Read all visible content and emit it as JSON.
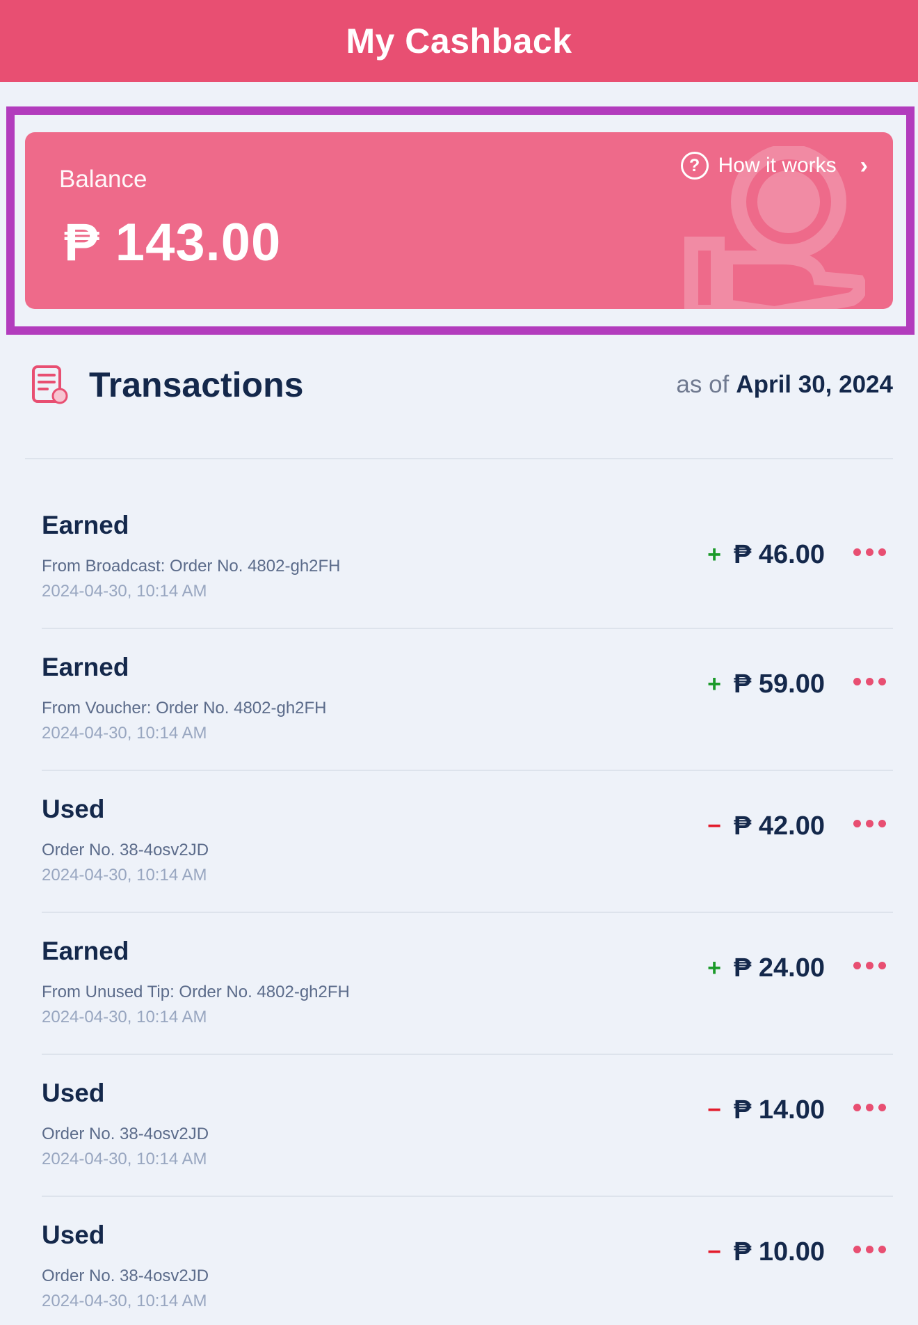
{
  "header": {
    "title": "My Cashback"
  },
  "balance": {
    "label": "Balance",
    "amount": "₱ 143.00",
    "how_it_works": "How it works",
    "help_icon": "question-circle-icon",
    "chevron_icon": "chevron-right-icon"
  },
  "transactions": {
    "title": "Transactions",
    "as_of_prefix": "as of",
    "as_of_date": "April 30, 2024",
    "items": [
      {
        "type": "Earned",
        "description": "From Broadcast: Order No. 4802-gh2FH",
        "timestamp": "2024-04-30, 10:14 AM",
        "sign": "+",
        "amount": "₱ 46.00"
      },
      {
        "type": "Earned",
        "description": "From Voucher: Order No. 4802-gh2FH",
        "timestamp": "2024-04-30, 10:14 AM",
        "sign": "+",
        "amount": "₱ 59.00"
      },
      {
        "type": "Used",
        "description": "Order No. 38-4osv2JD",
        "timestamp": "2024-04-30, 10:14 AM",
        "sign": "−",
        "amount": "₱ 42.00"
      },
      {
        "type": "Earned",
        "description": "From Unused Tip: Order No. 4802-gh2FH",
        "timestamp": "2024-04-30, 10:14 AM",
        "sign": "+",
        "amount": "₱ 24.00"
      },
      {
        "type": "Used",
        "description": "Order No. 38-4osv2JD",
        "timestamp": "2024-04-30, 10:14 AM",
        "sign": "−",
        "amount": "₱ 14.00"
      },
      {
        "type": "Used",
        "description": "Order No. 38-4osv2JD",
        "timestamp": "2024-04-30, 10:14 AM",
        "sign": "−",
        "amount": "₱ 10.00"
      }
    ]
  },
  "colors": {
    "header_bg": "#e84f72",
    "card_bg": "#ee6a8a",
    "highlight_border": "#b23cbd",
    "positive": "#1b9a2a",
    "negative": "#e31b2b",
    "page_bg": "#eef2f9"
  }
}
